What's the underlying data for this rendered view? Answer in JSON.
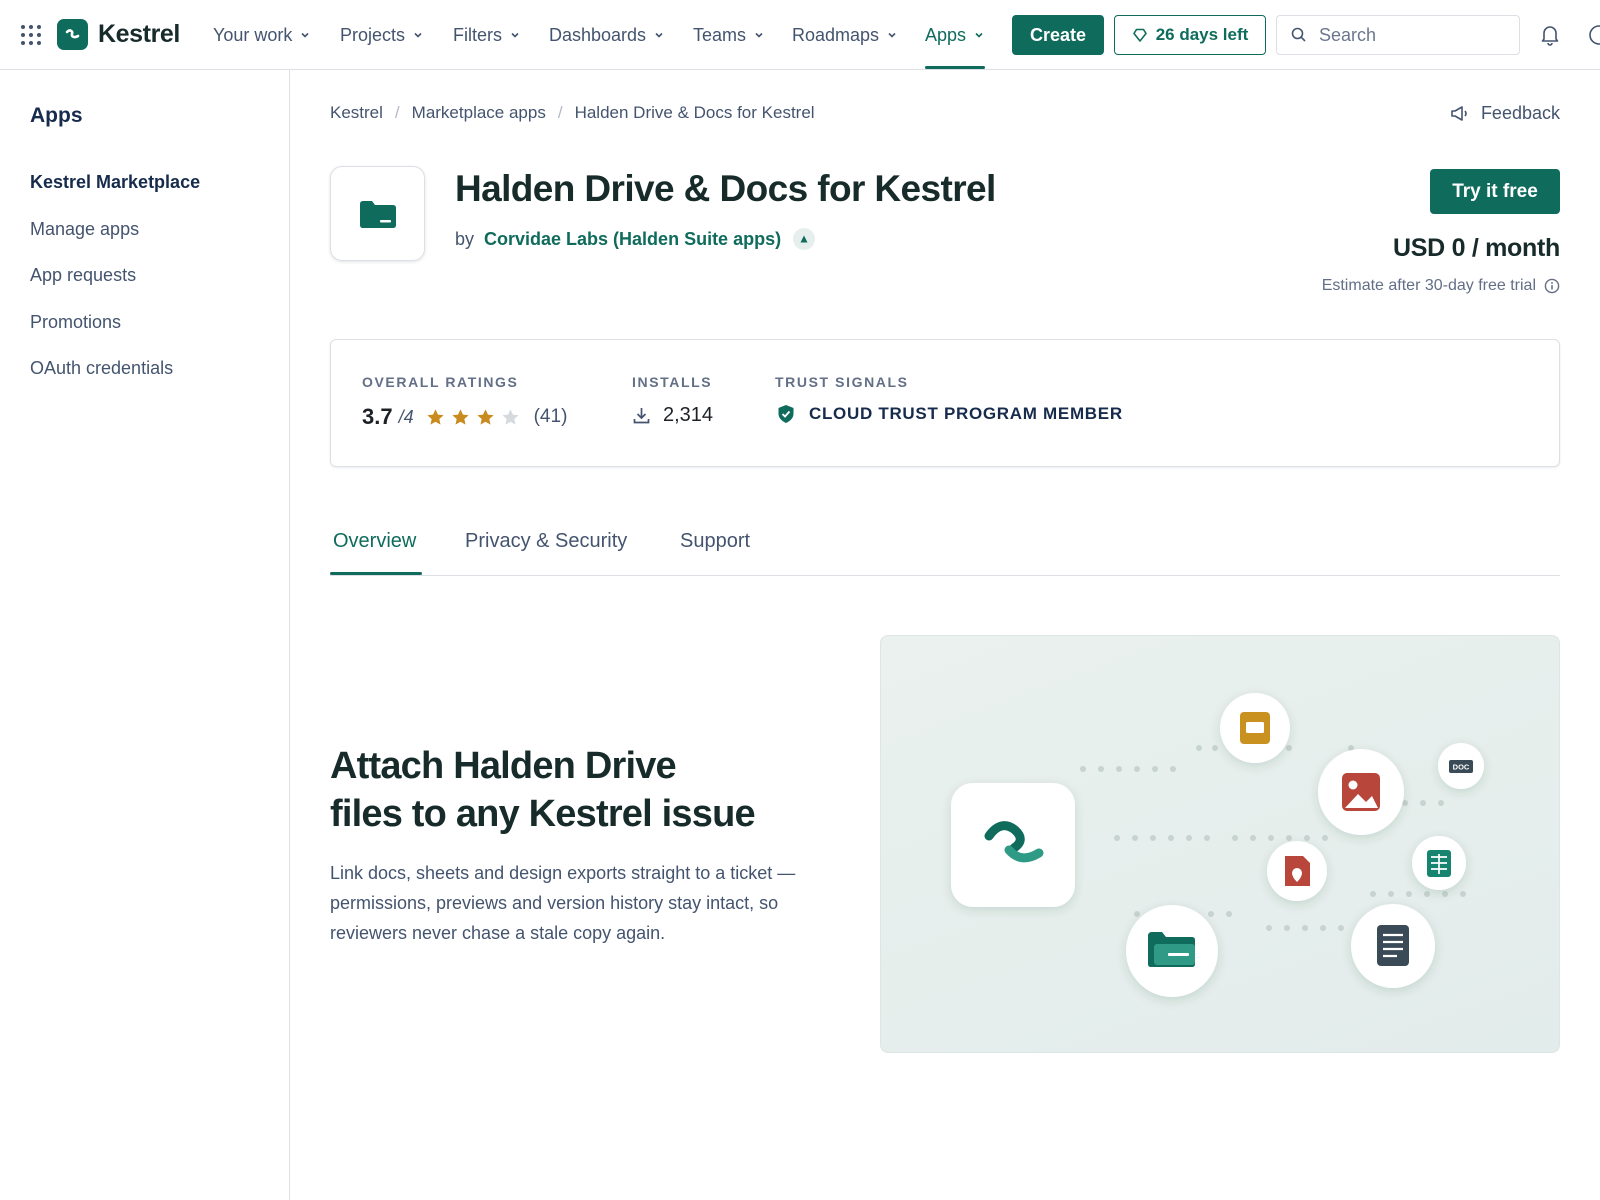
{
  "brand": {
    "name": "Kestrel"
  },
  "nav": {
    "items": [
      {
        "label": "Your work"
      },
      {
        "label": "Projects"
      },
      {
        "label": "Filters"
      },
      {
        "label": "Dashboards"
      },
      {
        "label": "Teams"
      },
      {
        "label": "Roadmaps"
      },
      {
        "label": "Apps"
      }
    ],
    "active": "Apps",
    "create_label": "Create",
    "trial_label": "26 days left",
    "search_placeholder": "Search"
  },
  "sidebar": {
    "title": "Apps",
    "items": [
      {
        "label": "Kestrel Marketplace",
        "selected": true
      },
      {
        "label": "Manage apps"
      },
      {
        "label": "App requests"
      },
      {
        "label": "Promotions"
      },
      {
        "label": "OAuth credentials"
      }
    ]
  },
  "breadcrumbs": [
    "Kestrel",
    "Marketplace apps",
    "Halden Drive & Docs for Kestrel"
  ],
  "feedback_label": "Feedback",
  "app": {
    "title": "Halden Drive & Docs for Kestrel",
    "by_label": "by",
    "vendor": "Corvidae Labs (Halden Suite apps)",
    "try_label": "Try it free",
    "price": "USD 0 / month",
    "estimate": "Estimate after 30-day free trial"
  },
  "stats": {
    "ratings_label": "OVERALL RATINGS",
    "rating": "3.7",
    "rating_scale": "/4",
    "stars_filled": 3,
    "stars_total": 4,
    "rating_count": "(41)",
    "installs_label": "INSTALLS",
    "installs": "2,314",
    "trust_label": "TRUST SIGNALS",
    "trust_value": "CLOUD TRUST PROGRAM MEMBER"
  },
  "tabs": [
    {
      "label": "Overview",
      "active": true
    },
    {
      "label": "Privacy & Security"
    },
    {
      "label": "Support"
    }
  ],
  "hero": {
    "title_line1": "Attach Halden Drive",
    "title_line2": "files to any Kestrel issue",
    "description": "Link docs, sheets and design exports straight to a ticket — permissions, previews and version history stay intact, so reviewers never chase a stale copy again."
  },
  "illustration": {
    "doc_badge": "DOC",
    "icons": [
      "slides-icon",
      "image-icon",
      "doc-badge-icon",
      "pdf-icon",
      "sheets-icon",
      "folder-icon",
      "document-icon"
    ]
  },
  "colors": {
    "brand": "#0f6b5c",
    "text": "#172b2a",
    "muted": "#44546f",
    "star": "#c98a1e",
    "border": "#dcdfe4"
  }
}
